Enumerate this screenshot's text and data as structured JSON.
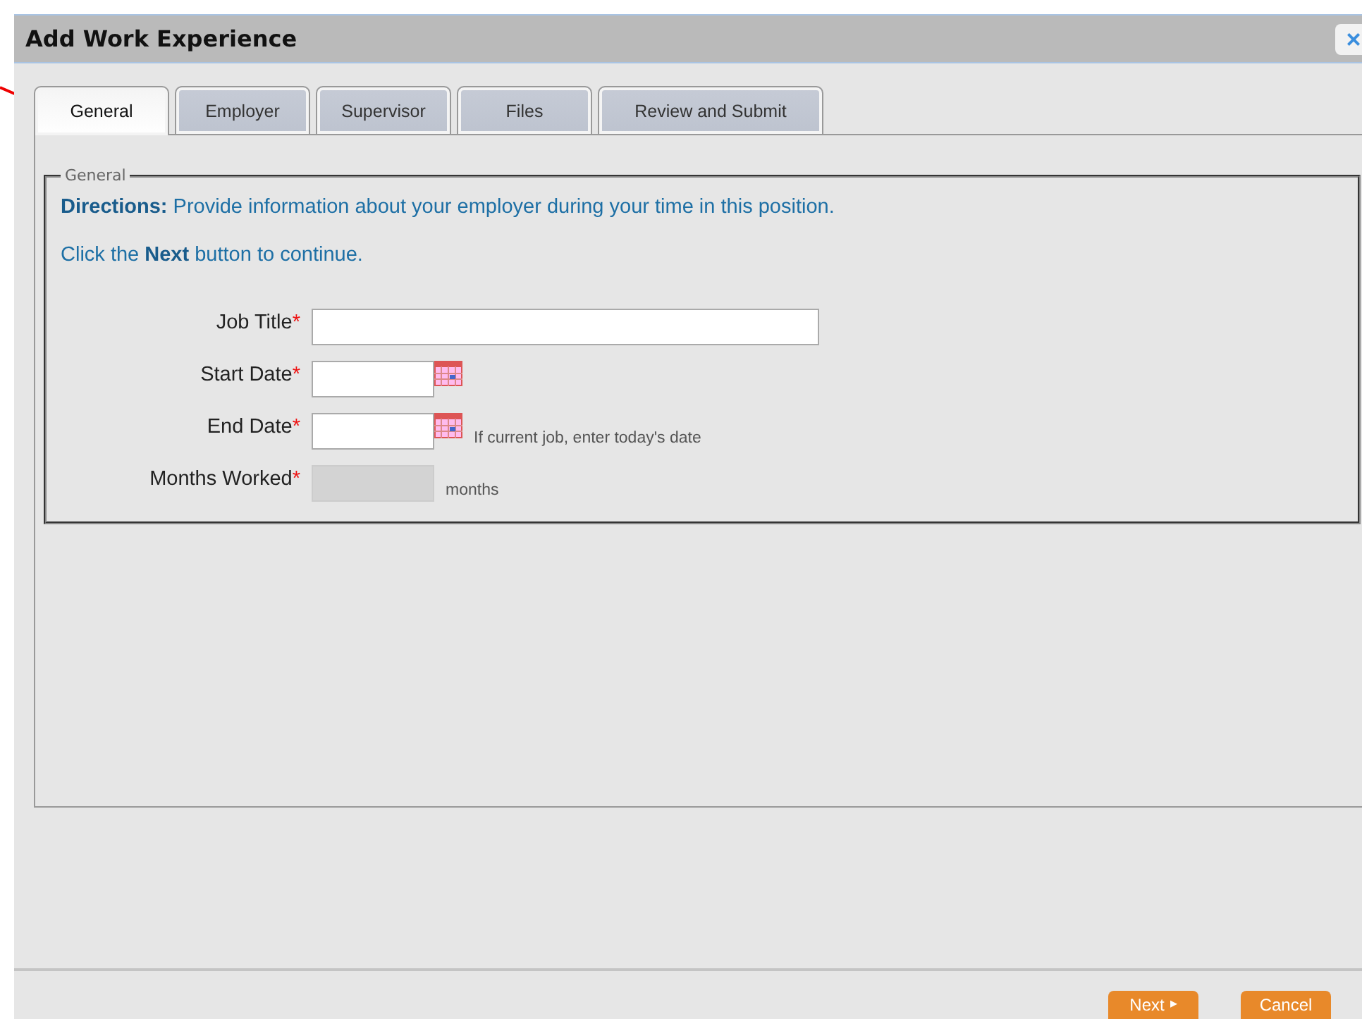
{
  "window": {
    "title": "Add Work Experience",
    "close": "×"
  },
  "tabs": [
    {
      "label": "General",
      "selected": true
    },
    {
      "label": "Employer",
      "selected": false
    },
    {
      "label": "Supervisor",
      "selected": false
    },
    {
      "label": "Files",
      "selected": false
    },
    {
      "label": "Review and Submit",
      "selected": false
    }
  ],
  "section": {
    "legend": "General",
    "directions": "**Directions:** Provide information about your employer during your time in this position.",
    "instruction": "Click the **Next** button to continue."
  },
  "fields": [
    {
      "kind": "text",
      "label": "Job Title",
      "required_mark": "*"
    },
    {
      "kind": "date",
      "label": "Start Date",
      "required_mark": "*"
    },
    {
      "kind": "date",
      "label": "End Date",
      "required_mark": "*",
      "hint": "If current job, enter today's date"
    },
    {
      "kind": "readonly",
      "label": "Months Worked",
      "required_mark": "*",
      "suffix": "months",
      "disabled": true
    }
  ],
  "buttons": [
    {
      "label": "Next",
      "icon": "▸"
    },
    {
      "label": "Cancel"
    }
  ]
}
